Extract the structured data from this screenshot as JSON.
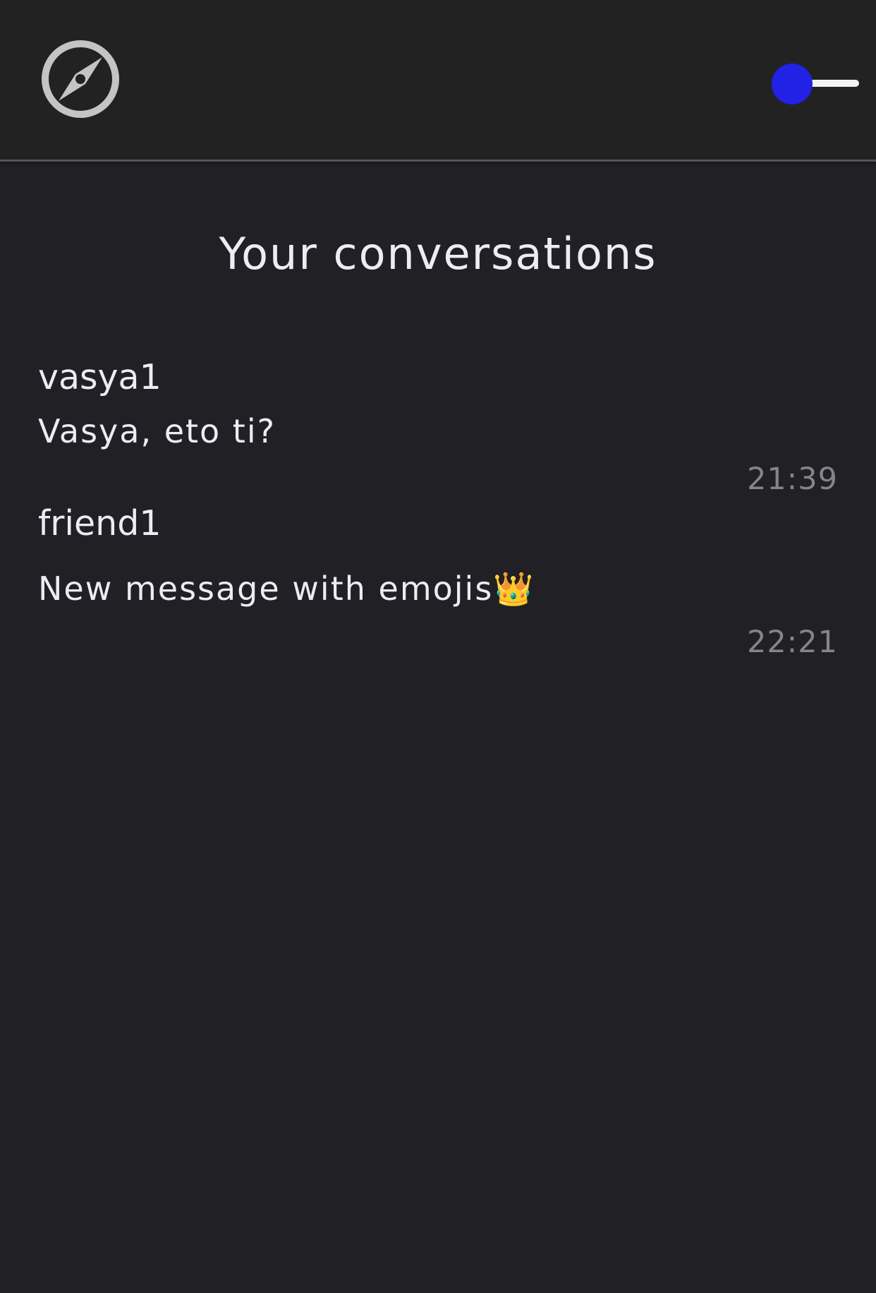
{
  "header": {
    "explore_icon": "compass-icon",
    "theme_toggle": {
      "icon": "toggle-switch",
      "knob_color": "#2222e6",
      "track_color": "#f2f2f2",
      "state": "off"
    }
  },
  "main": {
    "title": "Your conversations",
    "conversations": [
      {
        "name": "vasya1",
        "last_message": "Vasya, eto ti?",
        "time": "21:39"
      },
      {
        "name": "friend1",
        "last_message": "New message with emojis👑",
        "time": "22:21"
      }
    ]
  },
  "colors": {
    "background": "#212025",
    "header_background": "#222222",
    "text": "#ecebf6",
    "muted_text": "#85848b",
    "icon": "#c4c4c4",
    "accent": "#2222e6"
  }
}
